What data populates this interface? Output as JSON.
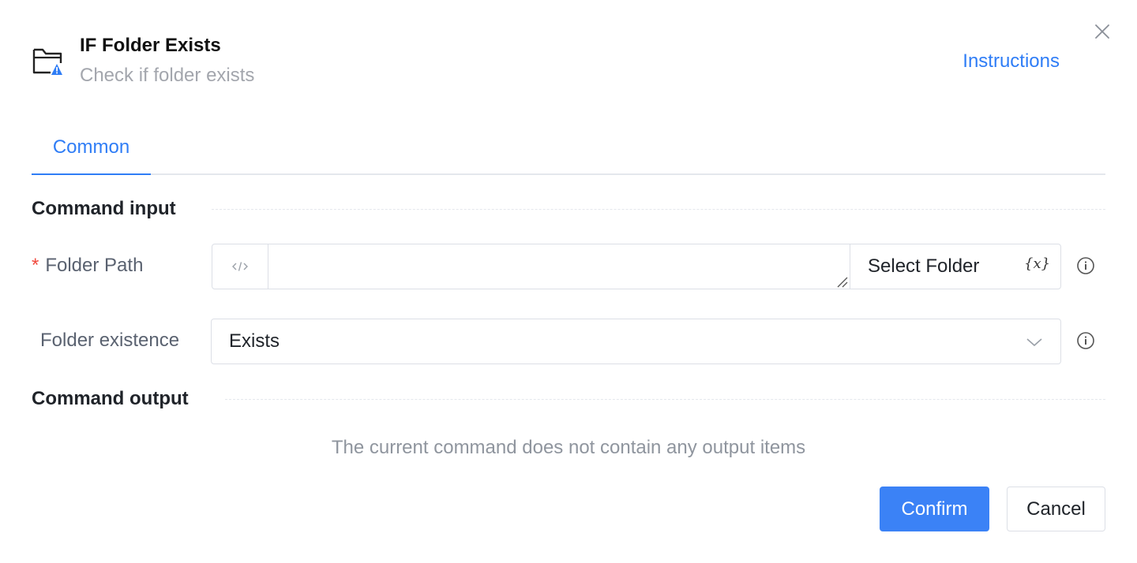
{
  "dialog": {
    "title": "IF Folder Exists",
    "subtitle": "Check if folder exists",
    "instructions_label": "Instructions",
    "close_icon": "close-icon",
    "header_icon": "folder-warning-icon"
  },
  "tabs": [
    {
      "label": "Common",
      "active": true
    }
  ],
  "command_input": {
    "section_title": "Command input",
    "folder_path": {
      "required_mark": "*",
      "label": "Folder Path",
      "value": "",
      "code_icon": "code-icon",
      "select_button_label": "Select Folder",
      "variable_icon_text": "{x}"
    },
    "folder_existence": {
      "label": "Folder existence",
      "selected": "Exists"
    }
  },
  "command_output": {
    "section_title": "Command output",
    "empty_message": "The current command does not contain any output items"
  },
  "footer": {
    "confirm_label": "Confirm",
    "cancel_label": "Cancel"
  },
  "colors": {
    "accent": "#2f7df6",
    "primary_button": "#3b82f6",
    "required": "#f0493d",
    "muted_text": "#a3a6ad",
    "border": "#dcdfe6"
  }
}
